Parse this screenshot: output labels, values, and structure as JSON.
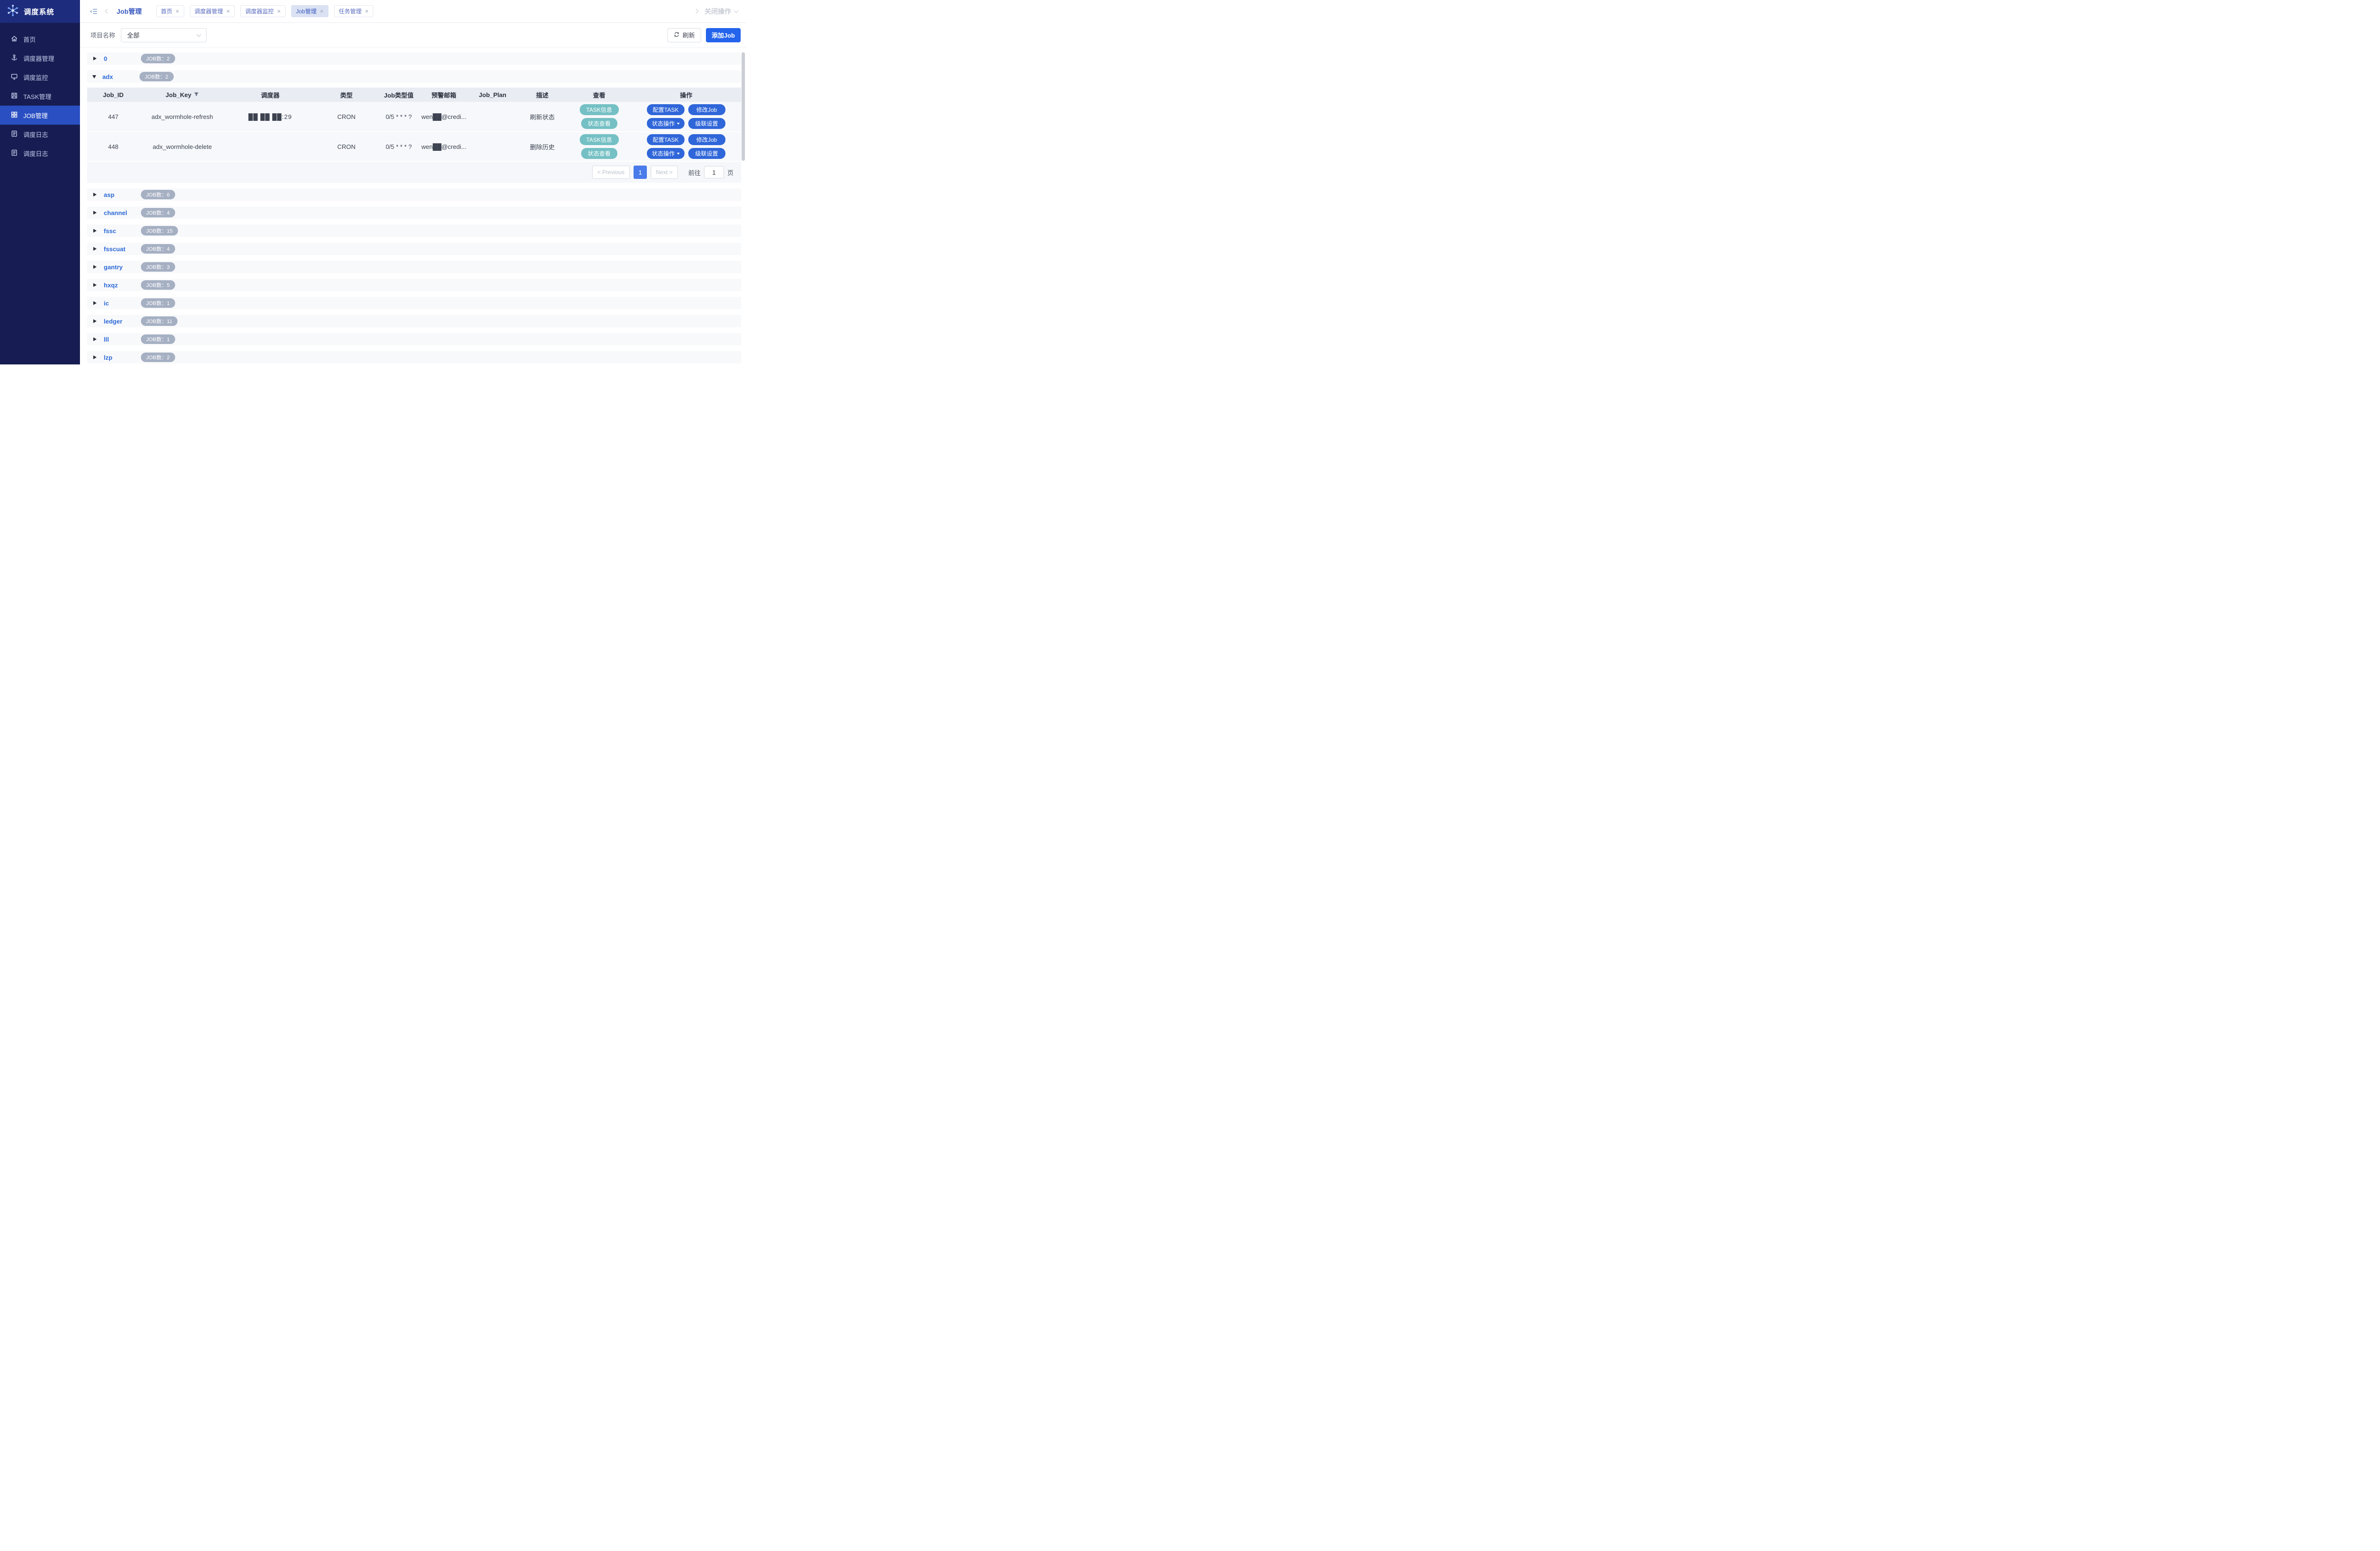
{
  "app": {
    "title": "调度系统"
  },
  "sidebar": {
    "items": [
      {
        "label": "首页"
      },
      {
        "label": "调度器管理"
      },
      {
        "label": "调度监控"
      },
      {
        "label": "TASK管理"
      },
      {
        "label": "JOB管理"
      },
      {
        "label": "调度日志"
      },
      {
        "label": "调度日志"
      }
    ]
  },
  "topbar": {
    "page_title": "Job管理",
    "tabs": [
      {
        "label": "首页"
      },
      {
        "label": "调度器管理"
      },
      {
        "label": "调度器监控"
      },
      {
        "label": "Job管理"
      },
      {
        "label": "任务管理"
      }
    ],
    "tab_close": "×",
    "close_ops": "关闭操作"
  },
  "filter": {
    "label": "项目名称",
    "selected": "全部",
    "refresh": "刷新",
    "add_job": "添加Job"
  },
  "groups": [
    {
      "name": "0",
      "badge": "JOB数：2"
    },
    {
      "name": "adx",
      "badge": "JOB数：2"
    },
    {
      "name": "asp",
      "badge": "JOB数：6"
    },
    {
      "name": "channel",
      "badge": "JOB数：4"
    },
    {
      "name": "fssc",
      "badge": "JOB数：15"
    },
    {
      "name": "fsscuat",
      "badge": "JOB数：4"
    },
    {
      "name": "gantry",
      "badge": "JOB数：3"
    },
    {
      "name": "hxqz",
      "badge": "JOB数：5"
    },
    {
      "name": "ic",
      "badge": "JOB数：1"
    },
    {
      "name": "ledger",
      "badge": "JOB数：11"
    },
    {
      "name": "lll",
      "badge": "JOB数：1"
    },
    {
      "name": "lzp",
      "badge": "JOB数：2"
    }
  ],
  "table": {
    "headers": [
      "Job_ID",
      "Job_Key",
      "调度器",
      "类型",
      "Job类型值",
      "预警邮箱",
      "Job_Plan",
      "描述",
      "查看",
      "操作"
    ],
    "rows": [
      {
        "id": "447",
        "key": "adx_wormhole-refresh",
        "scheduler": "██ ██ ██:29",
        "type": "CRON",
        "cron": "0/5 * * * ?",
        "email": "wen██@credi...",
        "plan": "",
        "desc": "刷新状态"
      },
      {
        "id": "448",
        "key": "adx_wormhole-delete",
        "scheduler": "",
        "type": "CRON",
        "cron": "0/5 * * * ?",
        "email": "wen██@credi...",
        "plan": "",
        "desc": "删除历史"
      }
    ]
  },
  "actions": {
    "task_info": "TASK信息",
    "status_view": "状态查看",
    "config_task": "配置TASK",
    "edit_job": "修改Job",
    "status_ops": "状态操作",
    "cascade": "级联设置"
  },
  "pagination": {
    "prev": "< Previous",
    "page": "1",
    "next": "Next >",
    "goto": "前往",
    "goto_value": "1",
    "unit": "页"
  },
  "colors": {
    "accent": "#2463eb",
    "sidebar": "#171d52",
    "sidebar_active": "#2a4fc2",
    "teal_button": "#74c0c4",
    "blue_button": "#2f66d9",
    "badge": "#a6b0c3"
  }
}
